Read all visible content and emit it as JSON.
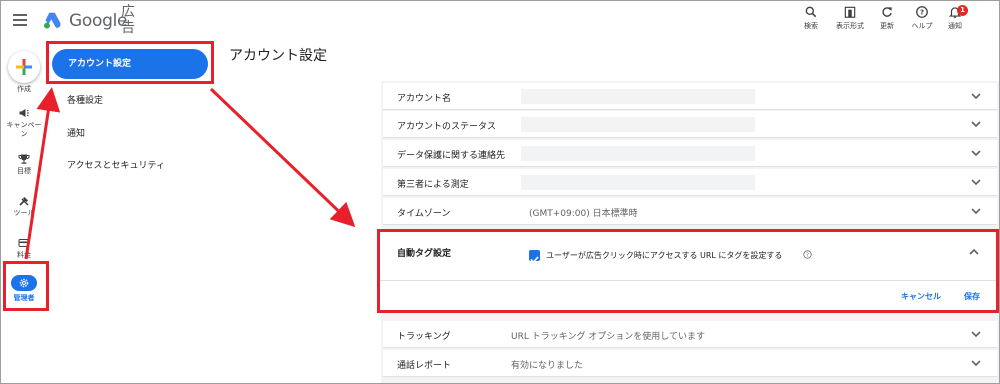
{
  "header": {
    "brand": "Google",
    "product": "広告",
    "tools": [
      {
        "label": "検索",
        "icon": "search-icon"
      },
      {
        "label": "表示形式",
        "icon": "appearance-icon"
      },
      {
        "label": "更新",
        "icon": "refresh-icon"
      },
      {
        "label": "ヘルプ",
        "icon": "help-icon"
      },
      {
        "label": "通知",
        "icon": "bell-icon"
      }
    ],
    "notification_count": "1"
  },
  "rail": {
    "create_label": "作成",
    "items": [
      {
        "label": "キャンペーン",
        "icon": "megaphone-icon"
      },
      {
        "label": "目標",
        "icon": "trophy-icon"
      },
      {
        "label": "ツール",
        "icon": "tools-icon"
      },
      {
        "label": "料金",
        "icon": "credit-card-icon"
      },
      {
        "label": "管理者",
        "icon": "gear-icon"
      }
    ]
  },
  "subnav": {
    "items": [
      "アカウント設定",
      "各種設定",
      "通知",
      "アクセスとセキュリティ"
    ]
  },
  "page": {
    "title": "アカウント設定"
  },
  "settings": {
    "rows": [
      {
        "label": "アカウント名",
        "value": ""
      },
      {
        "label": "アカウントのステータス",
        "value": ""
      },
      {
        "label": "データ保護に関する連絡先",
        "value": ""
      },
      {
        "label": "第三者による測定",
        "value": ""
      },
      {
        "label": "タイムゾーン",
        "value": "(GMT+09:00) 日本標準時"
      }
    ],
    "auto_tagging": {
      "label": "自動タグ設定",
      "checkbox_text": "ユーザーが広告クリック時にアクセスする URL にタグを設定する",
      "checked": true,
      "cancel": "キャンセル",
      "save": "保存"
    },
    "rows_after": [
      {
        "label": "トラッキング",
        "value": "URL トラッキング オプションを使用しています"
      },
      {
        "label": "通話レポート",
        "value": "有効になりました"
      }
    ]
  },
  "colors": {
    "accent": "#1a73e8",
    "annotation_red": "#e8202b"
  }
}
